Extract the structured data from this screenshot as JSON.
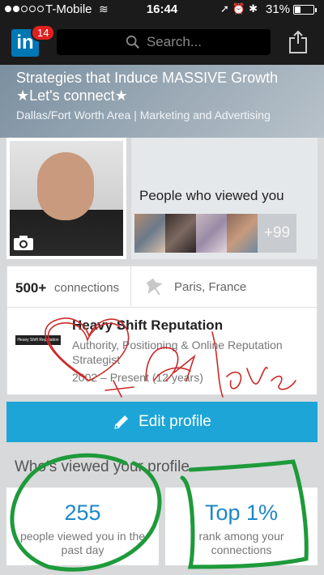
{
  "status_bar": {
    "carrier": "T-Mobile",
    "time": "16:44",
    "battery_percent": "31%",
    "battery_level": 0.31
  },
  "nav": {
    "notification_count": "14",
    "search_placeholder": "Search..."
  },
  "profile": {
    "headline": "Strategies that Induce MASSIVE Growth ★Let's connect★",
    "location_industry": "Dallas/Fort Worth Area | Marketing and Advertising"
  },
  "viewed_card": {
    "title": "People who viewed you",
    "more_count": "+99"
  },
  "stats": {
    "connections_number": "500+",
    "connections_label": "connections",
    "location": "Paris, France"
  },
  "position": {
    "company_logo_text": "Heavy Shift Reputation",
    "company": "Heavy Shift Reputation",
    "title": "Authority, Positioning & Online Reputation Strategist",
    "dates": "2002 – Present (12 years)"
  },
  "edit_profile_label": "Edit profile",
  "who_viewed": {
    "title": "Who's viewed your profile",
    "views_number": "255",
    "views_caption": "people viewed you in the past day",
    "rank_number": "Top 1%",
    "rank_caption": "rank among your connections"
  },
  "colors": {
    "accent": "#1da5d8",
    "link_blue": "#1d87c8",
    "scribble_red": "#cc2a2a",
    "scribble_green": "#1e9a3a"
  }
}
